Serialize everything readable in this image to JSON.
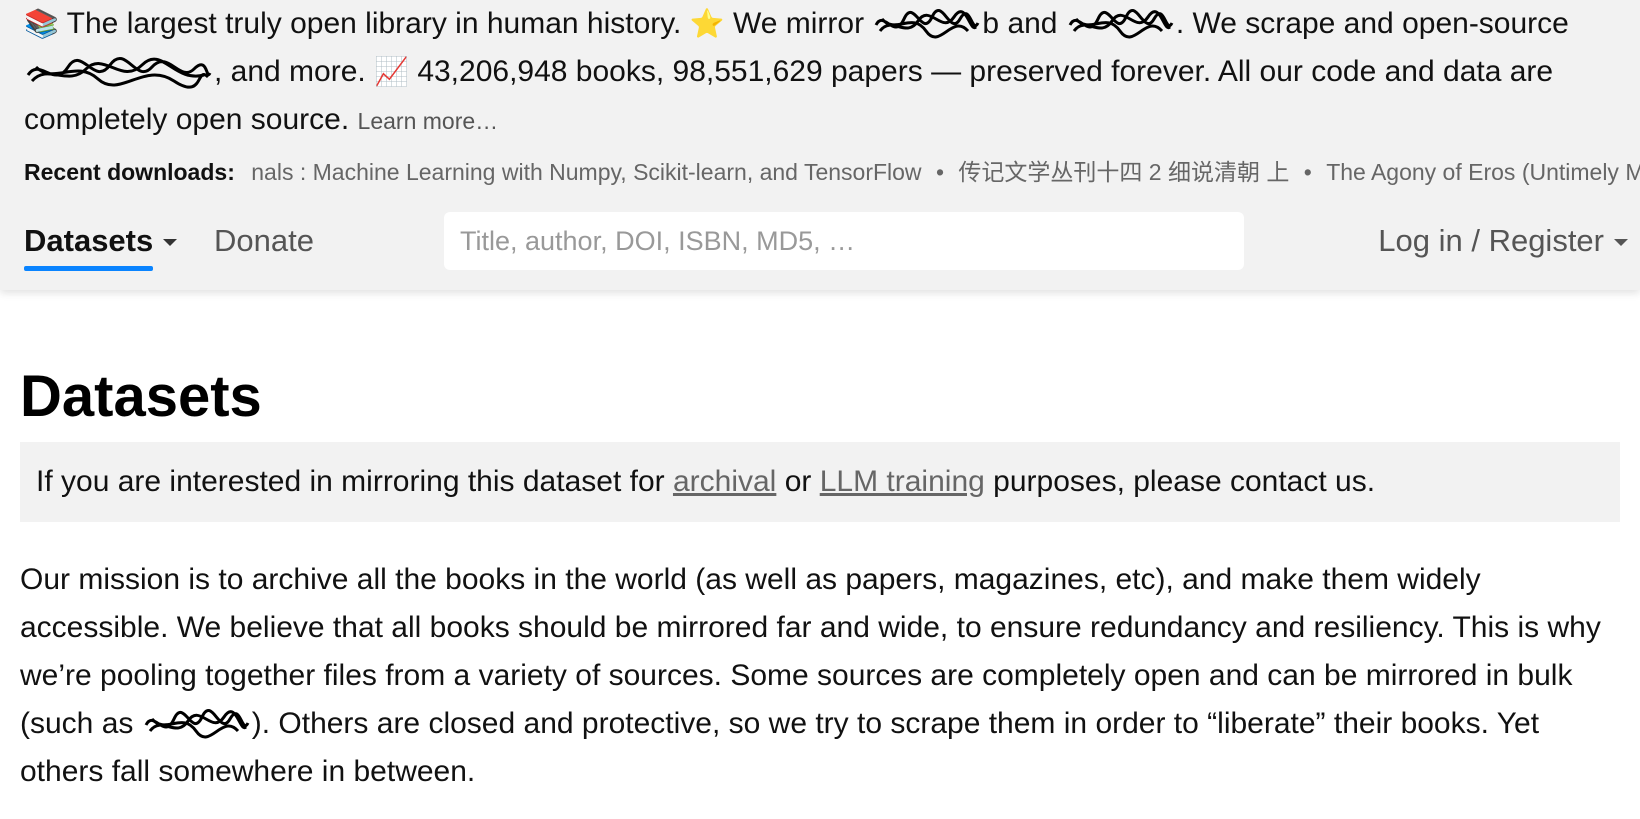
{
  "banner": {
    "icon_books": "📚",
    "text_1": "The largest truly open library in human history.",
    "icon_star": "⭐",
    "text_2": "We mirror",
    "text_3": "b and",
    "text_4": ". We scrape and open-source",
    "text_5": ", and more.",
    "icon_chart": "📈",
    "text_6": "43,206,948 books, 98,551,629 papers — preserved forever. All our code and data are completely open source.",
    "learn_more": "Learn more…"
  },
  "recent": {
    "label": "Recent downloads:",
    "items": [
      "nals : Machine Learning with Numpy, Scikit-learn, and TensorFlow",
      "传记文学丛刊十四 2 细说清朝 上",
      "The Agony of Eros (Untimely Meditations)"
    ],
    "separator": "•"
  },
  "nav": {
    "datasets_label": "Datasets",
    "donate_label": "Donate",
    "search_placeholder": "Title, author, DOI, ISBN, MD5, …",
    "login_label": "Log in / Register",
    "active_color": "#0a84ff"
  },
  "main": {
    "title": "Datasets",
    "notice": {
      "text_1": "If you are interested in mirroring this dataset for",
      "link_archival": "archival",
      "text_2": "or",
      "link_llm": "LLM training",
      "text_3": "purposes, please contact us."
    },
    "mission": {
      "text_1": "Our mission is to archive all the books in the world (as well as papers, magazines, etc), and make them widely accessible. We believe that all books should be mirrored far and wide, to ensure redundancy and resiliency. This is why we’re pooling together files from a variety of sources. Some sources are completely open and can be mirrored in bulk (such as",
      "text_2": "). Others are closed and protective, so we try to scrape them in order to “liberate” their books. Yet others fall somewhere in between."
    }
  }
}
